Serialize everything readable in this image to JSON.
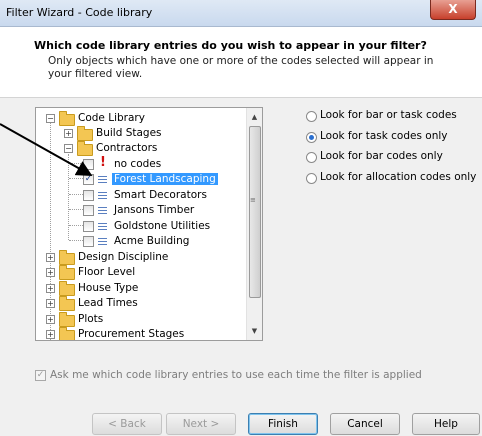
{
  "window": {
    "title": "Filter Wizard - Code library",
    "close_glyph": "X"
  },
  "header": {
    "question": "Which code library entries do you wish to appear in your filter?",
    "description": "Only objects which have one or more of the codes selected will appear in your filtered view."
  },
  "tree": {
    "root": "Code Library",
    "build_stages": "Build Stages",
    "contractors": "Contractors",
    "no_codes": "no codes",
    "forest": "Forest Landscaping",
    "smart": "Smart Decorators",
    "jansons": "Jansons Timber",
    "goldstone": "Goldstone Utilities",
    "acme": "Acme Building",
    "design": "Design Discipline",
    "floor": "Floor Level",
    "house": "House Type",
    "lead": "Lead Times",
    "plots": "Plots",
    "procurement": "Procurement Stages",
    "checked_item": "Forest Landscaping"
  },
  "options": {
    "bar_or_task": "Look for bar or task codes",
    "task_only": "Look for task codes only",
    "bar_only": "Look for bar codes only",
    "allocation_only": "Look for allocation codes only",
    "selected": "Look for task codes only"
  },
  "ask_label": "Ask me which code library entries to use each time the filter is applied",
  "buttons": {
    "back": "< Back",
    "next": "Next >",
    "finish": "Finish",
    "cancel": "Cancel",
    "help": "Help"
  }
}
